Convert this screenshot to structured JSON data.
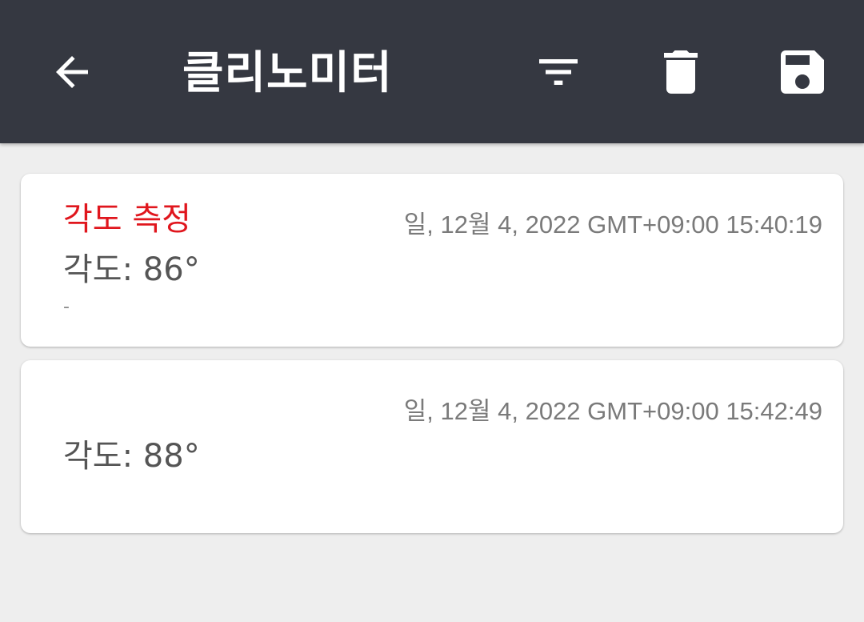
{
  "header": {
    "title": "클리노미터",
    "back_icon": "arrow-left-icon",
    "filter_icon": "filter-icon",
    "delete_icon": "trash-icon",
    "save_icon": "floppy-disk-icon",
    "background": "#353841"
  },
  "records": [
    {
      "title": "각도 측정",
      "date": "일, 12월 4, 2022 GMT+09:00 15:40:19",
      "value": "각도: 86°",
      "note": "-"
    },
    {
      "title": "",
      "date": "일, 12월 4, 2022 GMT+09:00 15:42:49",
      "value": "각도: 88°",
      "note": ""
    }
  ],
  "colors": {
    "accent_title": "#e0161d",
    "page_background": "#eeeeee"
  }
}
